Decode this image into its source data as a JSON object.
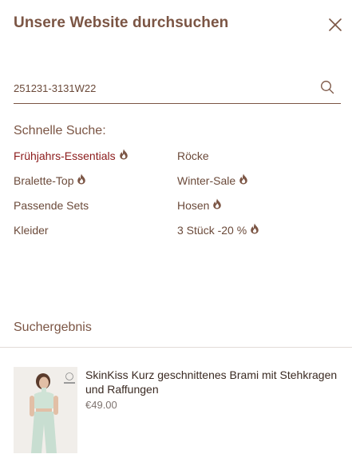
{
  "header": {
    "title": "Unsere Website durchsuchen"
  },
  "search": {
    "value": "251231-3131W22",
    "placeholder": ""
  },
  "quick_search": {
    "title": "Schnelle Suche:",
    "items": [
      {
        "label": "Frühjahrs-Essentials",
        "hot": true,
        "active": true
      },
      {
        "label": "Röcke",
        "hot": false,
        "active": false
      },
      {
        "label": "Bralette-Top",
        "hot": true,
        "active": false
      },
      {
        "label": "Winter-Sale",
        "hot": true,
        "active": false
      },
      {
        "label": "Passende Sets",
        "hot": false,
        "active": false
      },
      {
        "label": "Hosen",
        "hot": true,
        "active": false
      },
      {
        "label": "Kleider",
        "hot": false,
        "active": false
      },
      {
        "label": "3 Stück -20 %",
        "hot": true,
        "active": false
      }
    ]
  },
  "results": {
    "title": "Suchergebnis",
    "products": [
      {
        "name": "SkinKiss Kurz geschnittenes Brami mit Stehkragen und Raffungen",
        "price": "€49.00",
        "image": "product-photo-mint-outfit"
      }
    ]
  },
  "colors": {
    "accent": "#7b5544",
    "active_link": "#8b1a1a",
    "flame": "#7b5544"
  },
  "icons": {
    "close": "close-icon",
    "search": "search-icon",
    "hot": "flame-icon"
  }
}
